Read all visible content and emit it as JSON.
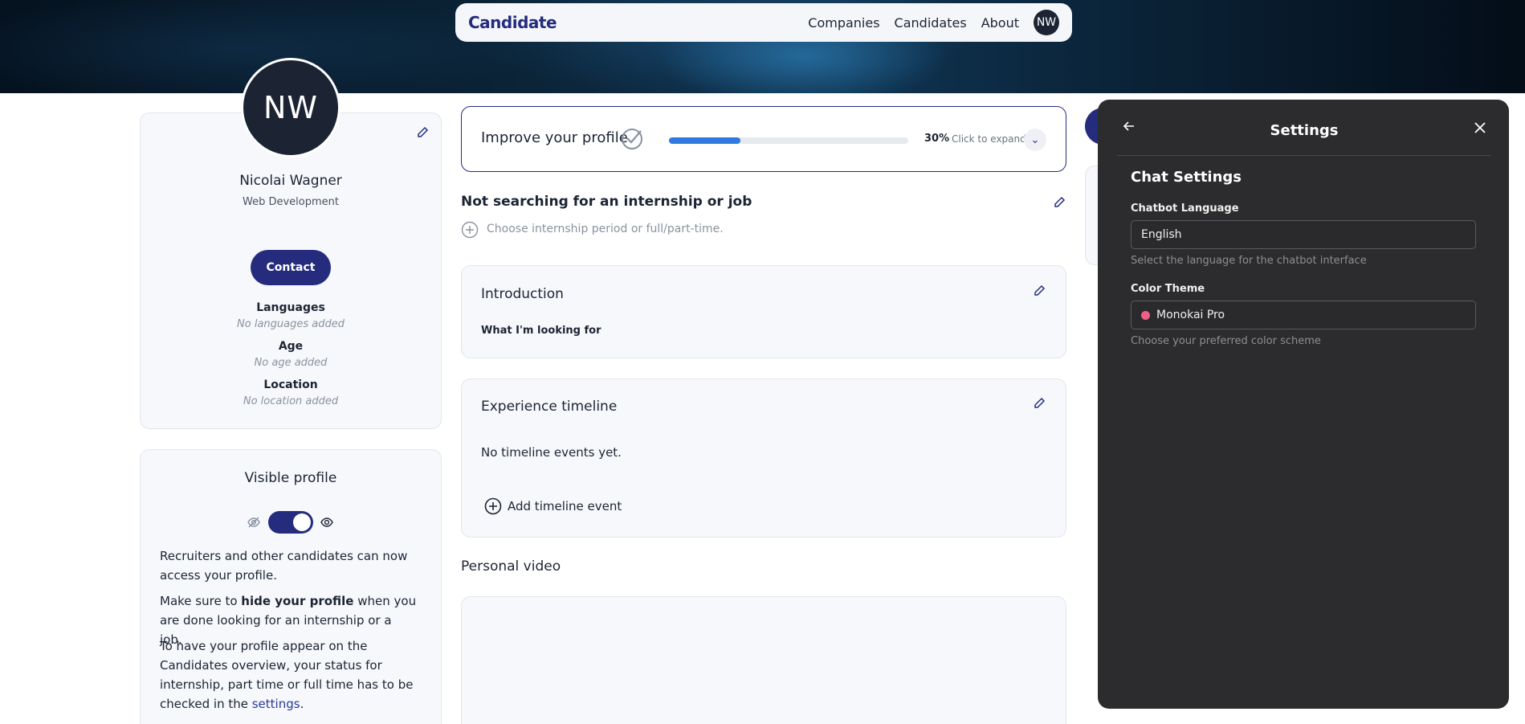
{
  "nav": {
    "logo": "Candidate",
    "links": [
      "Companies",
      "Candidates",
      "About"
    ],
    "avatar_initials": "NW"
  },
  "profile": {
    "initials": "NW",
    "name": "Nicolai Wagner",
    "field": "Web Development",
    "contact_label": "Contact",
    "languages_label": "Languages",
    "languages_value": "No languages added",
    "age_label": "Age",
    "age_value": "No age added",
    "location_label": "Location",
    "location_value": "No location added"
  },
  "visibility": {
    "title": "Visible profile",
    "toggle_on": true,
    "para1": "Recruiters and other candidates can now access your profile.",
    "para2_pre": "Make sure to ",
    "para2_bold": "hide your profile",
    "para2_post": " when you are done looking for an internship or a job.",
    "para3_pre": "To have your profile appear on the Candidates overview, your status for internship, part time or full time has to be checked in the ",
    "para3_link": "settings",
    "para3_post": "."
  },
  "improve": {
    "title": "Improve your profile",
    "progress_percent": 30,
    "progress_label": "30%",
    "expand_label": "Click to expand"
  },
  "search_status": {
    "title": "Not searching for an internship or job",
    "hint": "Choose internship period or full/part-time."
  },
  "introduction": {
    "title": "Introduction",
    "subheading": "What I'm looking for"
  },
  "experience": {
    "title": "Experience timeline",
    "empty": "No timeline events yet.",
    "add_label": "Add timeline event"
  },
  "video": {
    "title": "Personal video"
  },
  "settings": {
    "title": "Settings",
    "section": "Chat Settings",
    "language_label": "Chatbot Language",
    "language_value": "English",
    "language_hint": "Select the language for the chatbot interface",
    "theme_label": "Color Theme",
    "theme_value": "Monokai Pro",
    "theme_dot_color": "#f25f86",
    "theme_hint": "Choose your preferred color scheme"
  },
  "colors": {
    "brand": "#252c7d",
    "progress": "#2e7be0",
    "panel_bg": "#2c2c2e"
  }
}
